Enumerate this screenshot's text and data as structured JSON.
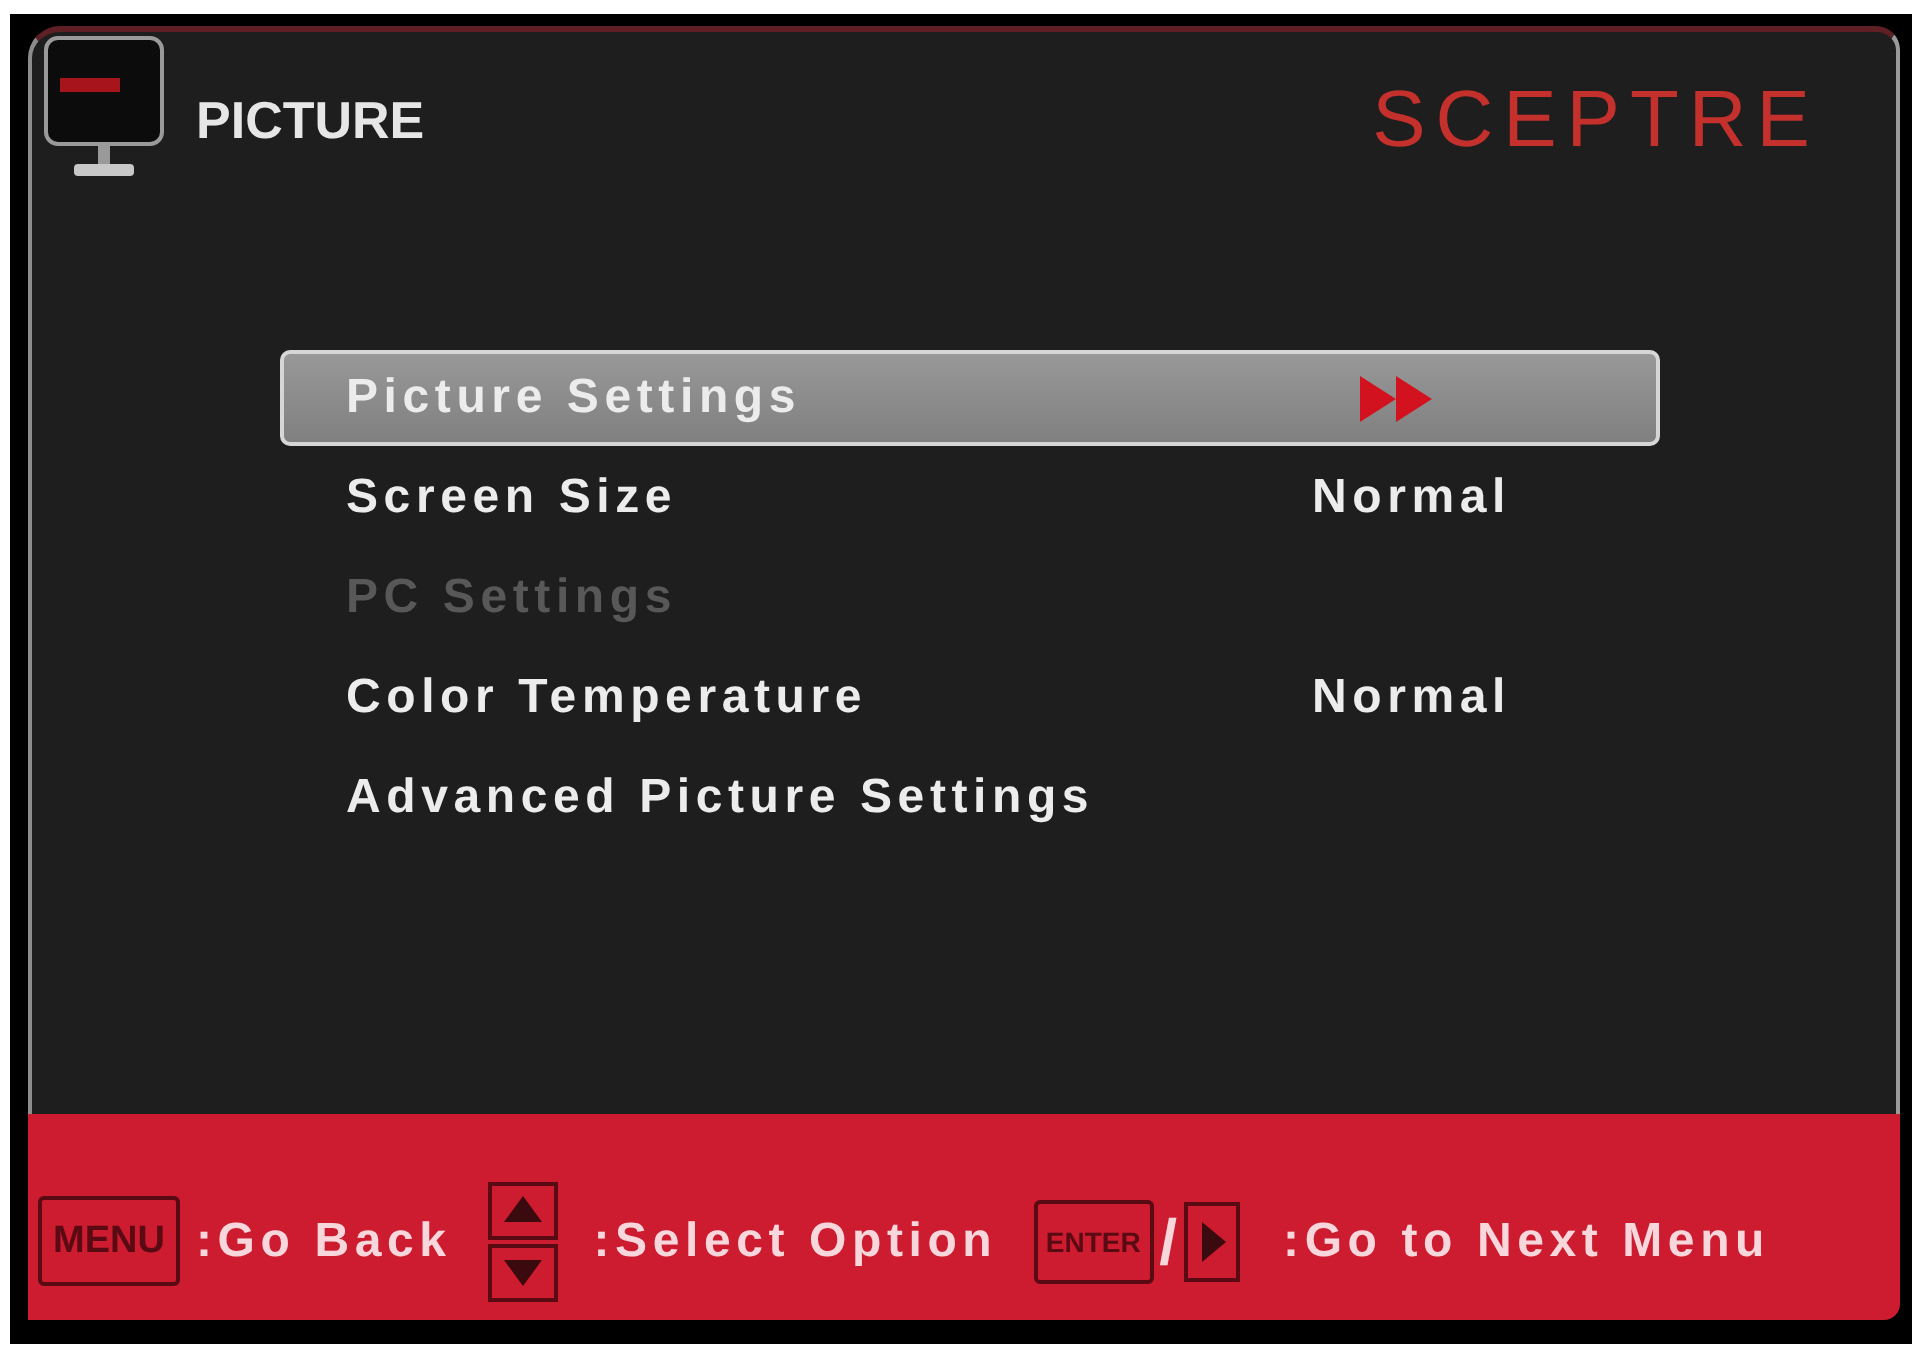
{
  "header": {
    "title": "PICTURE",
    "brand": "SCEPTRE"
  },
  "menu": {
    "items": [
      {
        "label": "Picture Settings",
        "kind": "submenu",
        "selected": true,
        "disabled": false
      },
      {
        "label": "Screen Size",
        "kind": "option",
        "value": "Normal",
        "selected": false,
        "disabled": false
      },
      {
        "label": "PC Settings",
        "kind": "submenu",
        "selected": false,
        "disabled": true
      },
      {
        "label": "Color Temperature",
        "kind": "option",
        "value": "Normal",
        "selected": false,
        "disabled": false
      },
      {
        "label": "Advanced Picture Settings",
        "kind": "submenu",
        "selected": false,
        "disabled": false
      }
    ]
  },
  "footer": {
    "hints": [
      {
        "kind": "key",
        "key": "MENU",
        "label": ":Go Back"
      },
      {
        "kind": "updown",
        "label": ":Select Option"
      },
      {
        "kind": "key-or-arrow",
        "key": "ENTER",
        "separator": "/",
        "label": ":Go to Next Menu"
      }
    ]
  }
}
